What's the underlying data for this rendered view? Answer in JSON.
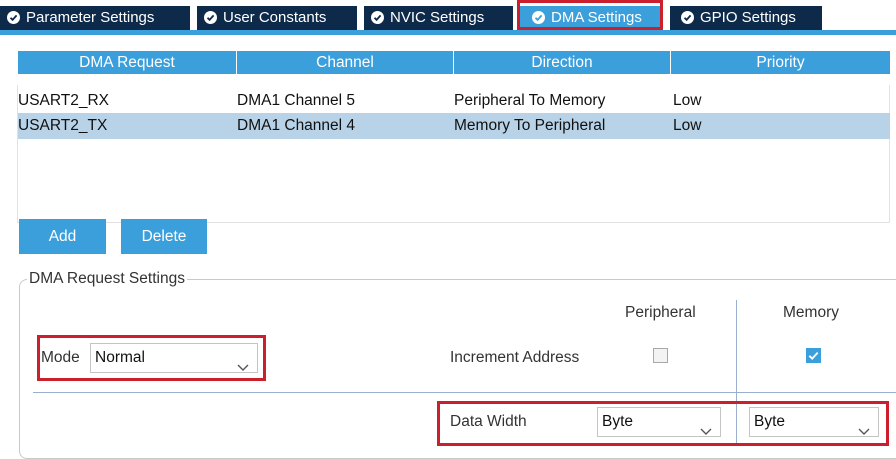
{
  "tabs": [
    {
      "label": "Parameter Settings",
      "active": false
    },
    {
      "label": "User Constants",
      "active": false
    },
    {
      "label": "NVIC Settings",
      "active": false
    },
    {
      "label": "DMA Settings",
      "active": true
    },
    {
      "label": "GPIO Settings",
      "active": false
    }
  ],
  "table": {
    "headers": [
      "DMA Request",
      "Channel",
      "Direction",
      "Priority"
    ],
    "rows": [
      {
        "request": "USART2_RX",
        "channel": "DMA1 Channel 5",
        "direction": "Peripheral To Memory",
        "priority": "Low",
        "selected": false
      },
      {
        "request": "USART2_TX",
        "channel": "DMA1 Channel 4",
        "direction": "Memory To Peripheral",
        "priority": "Low",
        "selected": true
      }
    ]
  },
  "buttons": {
    "add": "Add",
    "delete": "Delete"
  },
  "settings": {
    "group_title": "DMA Request Settings",
    "mode_label": "Mode",
    "mode_value": "Normal",
    "col_peripheral": "Peripheral",
    "col_memory": "Memory",
    "increment_label": "Increment Address",
    "increment_peripheral": false,
    "increment_memory": true,
    "data_width_label": "Data Width",
    "data_width_peripheral": "Byte",
    "data_width_memory": "Byte"
  },
  "colors": {
    "tab_bg": "#0d2a4a",
    "accent": "#3b9fdc",
    "selected_row": "#b8d3e8",
    "highlight_box": "#cc1f2d"
  },
  "icons": {
    "tab_status": "check-circle-icon",
    "dropdown": "chevron-down-icon"
  }
}
